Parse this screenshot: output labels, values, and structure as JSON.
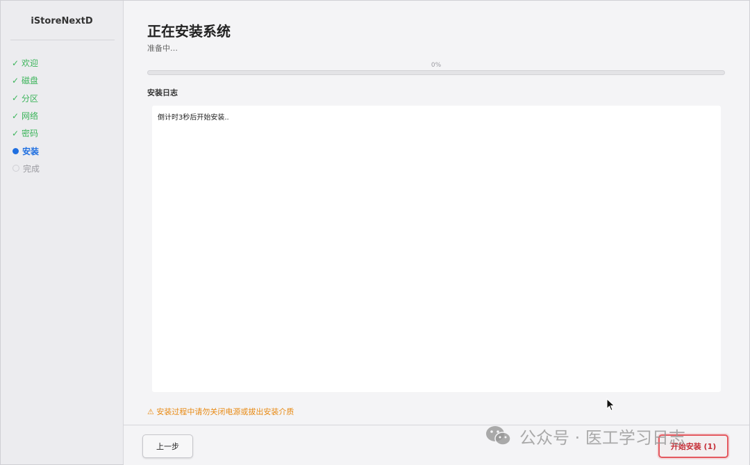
{
  "sidebar": {
    "brand": "iStoreNextD",
    "steps": [
      {
        "label": "欢迎",
        "state": "done",
        "mark": "✓"
      },
      {
        "label": "磁盘",
        "state": "done",
        "mark": "✓"
      },
      {
        "label": "分区",
        "state": "done",
        "mark": "✓"
      },
      {
        "label": "网络",
        "state": "done",
        "mark": "✓"
      },
      {
        "label": "密码",
        "state": "done",
        "mark": "✓"
      },
      {
        "label": "安装",
        "state": "current"
      },
      {
        "label": "完成",
        "state": "pending"
      }
    ]
  },
  "main": {
    "title": "正在安装系统",
    "subtitle": "准备中…",
    "progress": {
      "value": 0,
      "label": "0%"
    },
    "log": {
      "title": "安装日志",
      "content": "倒计时3秒后开始安装.."
    },
    "warning": "⚠ 安装过程中请勿关闭电源或拔出安装介质"
  },
  "footer": {
    "prev_label": "上一步",
    "start_label": "开始安装 (1)"
  },
  "watermark": {
    "text": "公众号 · 医工学习日志"
  },
  "colors": {
    "done": "#3bb45a",
    "current": "#1f6fe0",
    "pending": "#9a9aa0",
    "warning": "#e88a14",
    "danger": "#e4575d"
  }
}
